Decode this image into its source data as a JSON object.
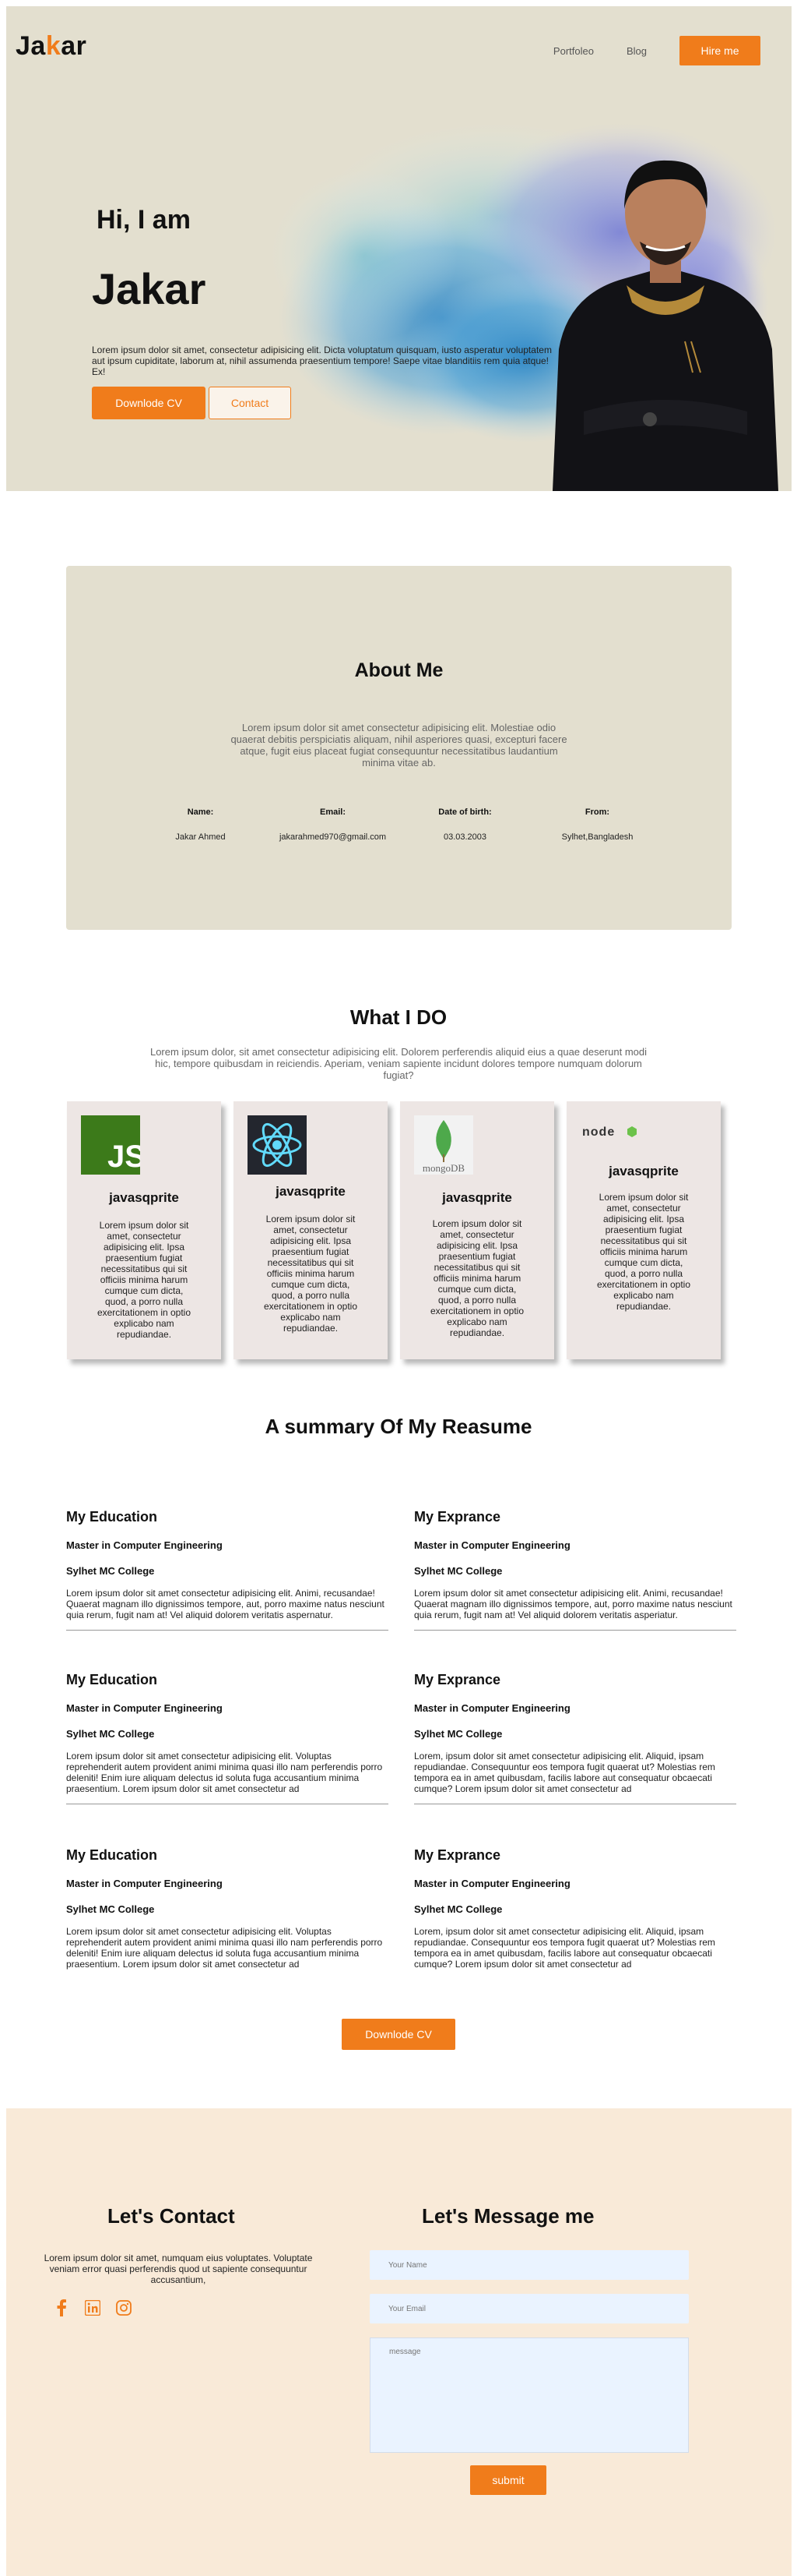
{
  "brand": {
    "logo_pre": "Ja",
    "logo_accent": "k",
    "logo_post": "ar",
    "accent_color": "#f07c1b"
  },
  "nav": {
    "portfolio": "Portfoleo",
    "blog": "Blog",
    "hire": "Hire me"
  },
  "hero": {
    "greeting": "Hi, I am",
    "name": "Jakar",
    "description": "Lorem ipsum dolor sit amet, consectetur adipisicing elit. Dicta voluptatum quisquam, iusto asperatur voluptatem aut ipsum cupiditate, laborum at, nihil assumenda praesentium tempore! Saepe vitae blanditiis rem quia atque! Ex!",
    "download_cv": "Downlode CV",
    "contact": "Contact"
  },
  "about": {
    "title": "About Me",
    "text": "Lorem ipsum dolor sit amet consectetur adipisicing elit. Molestiae odio quaerat debitis perspiciatis aliquam, nihil asperiores quasi, excepturi facere atque, fugit eius placeat fugiat consequuntur necessitatibus laudantium minima vitae ab.",
    "info": [
      {
        "label": "Name:",
        "value": "Jakar Ahmed"
      },
      {
        "label": "Email:",
        "value": "jakarahmed970@gmail.com"
      },
      {
        "label": "Date of birth:",
        "value": "03.03.2003"
      },
      {
        "label": "From:",
        "value": "Sylhet,Bangladesh"
      }
    ]
  },
  "services": {
    "title": "What I DO",
    "description": "Lorem ipsum dolor, sit amet consectetur adipisicing elit. Dolorem perferendis aliquid eius a quae deserunt modi hic, tempore quibusdam in reiciendis. Aperiam, veniam sapiente incidunt dolores tempore numquam dolorum fugiat?",
    "cards": [
      {
        "icon": "javascript-icon",
        "title": "javasqprite",
        "text": "Lorem ipsum dolor sit amet, consectetur adipisicing elit. Ipsa praesentium fugiat necessitatibus qui sit officiis minima harum cumque cum dicta, quod, a porro nulla exercitationem in optio explicabo nam repudiandae."
      },
      {
        "icon": "react-icon",
        "title": "javasqprite",
        "text": "Lorem ipsum dolor sit amet, consectetur adipisicing elit. Ipsa praesentium fugiat necessitatibus qui sit officiis minima harum cumque cum dicta, quod, a porro nulla exercitationem in optio explicabo nam repudiandae."
      },
      {
        "icon": "mongodb-icon",
        "icon_text": "mongoDB",
        "title": "javasqprite",
        "text": "Lorem ipsum dolor sit amet, consectetur adipisicing elit. Ipsa praesentium fugiat necessitatibus qui sit officiis minima harum cumque cum dicta, quod, a porro nulla exercitationem in optio explicabo nam repudiandae."
      },
      {
        "icon": "nodejs-icon",
        "icon_text": "node",
        "title": "javasqprite",
        "text": "Lorem ipsum dolor sit amet, consectetur adipisicing elit. Ipsa praesentium fugiat necessitatibus qui sit officiis minima harum cumque cum dicta, quod, a porro nulla exercitationem in optio explicabo nam repudiandae."
      }
    ]
  },
  "resume": {
    "title": "A summary Of My Reasume",
    "download_cv": "Downlode CV",
    "blocks": [
      {
        "heading": "My Education",
        "degree": "Master in Computer Engineering",
        "school": "Sylhet MC College",
        "text": "Lorem ipsum dolor sit amet consectetur adipisicing elit. Animi, recusandae! Quaerat magnam illo dignissimos tempore, aut, porro maxime natus nesciunt quia rerum, fugit nam at! Vel aliquid dolorem veritatis aspernatur."
      },
      {
        "heading": "My Exprance",
        "degree": "Master in Computer Engineering",
        "school": "Sylhet MC College",
        "text": "Lorem ipsum dolor sit amet consectetur adipisicing elit. Animi, recusandae! Quaerat magnam illo dignissimos tempore, aut, porro maxime natus nesciunt quia rerum, fugit nam at! Vel aliquid dolorem veritatis asperiatur."
      },
      {
        "heading": "My Education",
        "degree": "Master in Computer Engineering",
        "school": "Sylhet MC College",
        "text": "Lorem ipsum dolor sit amet consectetur adipisicing elit. Voluptas reprehenderit autem provident animi minima quasi illo nam perferendis porro deleniti! Enim iure aliquam delectus id soluta fuga accusantium minima praesentium. Lorem ipsum dolor sit amet consectetur ad"
      },
      {
        "heading": "My Exprance",
        "degree": "Master in Computer Engineering",
        "school": "Sylhet MC College",
        "text": "Lorem, ipsum dolor sit amet consectetur adipisicing elit. Aliquid, ipsam repudiandae. Consequuntur eos tempora fugit quaerat ut? Molestias rem tempora ea in amet quibusdam, facilis labore aut consequatur obcaecati cumque? Lorem ipsum dolor sit amet consectetur ad"
      },
      {
        "heading": "My Education",
        "degree": "Master in Computer Engineering",
        "school": "Sylhet MC College",
        "text": "Lorem ipsum dolor sit amet consectetur adipisicing elit. Voluptas reprehenderit autem provident animi minima quasi illo nam perferendis porro deleniti! Enim iure aliquam delectus id soluta fuga accusantium minima praesentium. Lorem ipsum dolor sit amet consectetur ad"
      },
      {
        "heading": "My Exprance",
        "degree": "Master in Computer Engineering",
        "school": "Sylhet MC College",
        "text": "Lorem, ipsum dolor sit amet consectetur adipisicing elit. Aliquid, ipsam repudiandae. Consequuntur eos tempora fugit quaerat ut? Molestias rem tempora ea in amet quibusdam, facilis labore aut consequatur obcaecati cumque? Lorem ipsum dolor sit amet consectetur ad"
      }
    ]
  },
  "contact": {
    "title": "Let's Contact",
    "text": "Lorem ipsum dolor sit amet, numquam eius voluptates. Voluptate veniam error quasi perferendis quod ut sapiente consequuntur accusantium,",
    "socials": [
      "facebook-icon",
      "linkedin-icon",
      "instagram-icon"
    ],
    "message_title": "Let's Message me",
    "name_placeholder": "Your Name",
    "email_placeholder": "Your Email",
    "message_placeholder": "message",
    "submit": "submit"
  }
}
